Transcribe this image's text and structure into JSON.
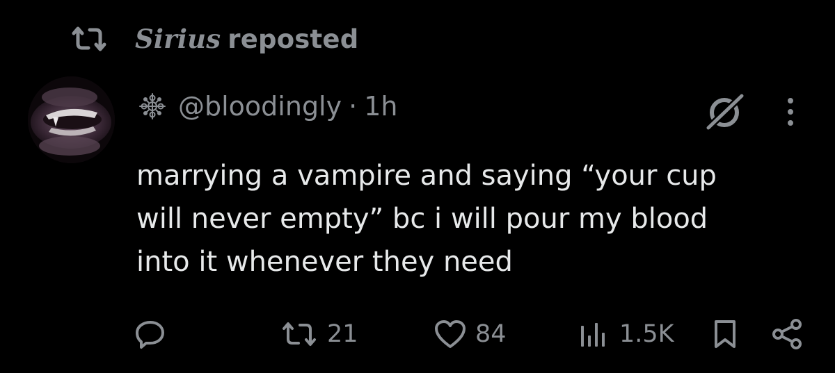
{
  "repost_banner": {
    "name": "Sirius",
    "label": "reposted"
  },
  "post": {
    "handle": "@bloodingly",
    "separator": "·",
    "time": "1h",
    "text": "marrying a vampire and saying “your cup\nwill never empty” bc i will pour my blood\ninto it whenever they need"
  },
  "actions": {
    "replies": "",
    "reposts": "21",
    "likes": "84",
    "views": "1.5K"
  },
  "icons": {
    "repost": "repost-icon",
    "avatar": "avatar-fangs-image",
    "sigil": "ornament-sigil-icon",
    "grok": "grok-icon",
    "more": "more-vertical-icon",
    "reply": "reply-bubble-icon",
    "like": "heart-icon",
    "views": "views-bars-icon",
    "bookmark": "bookmark-icon",
    "share": "share-icon"
  },
  "colors": {
    "background": "#000000",
    "text_primary": "#e7e9ea",
    "text_secondary": "#8b8f94"
  }
}
